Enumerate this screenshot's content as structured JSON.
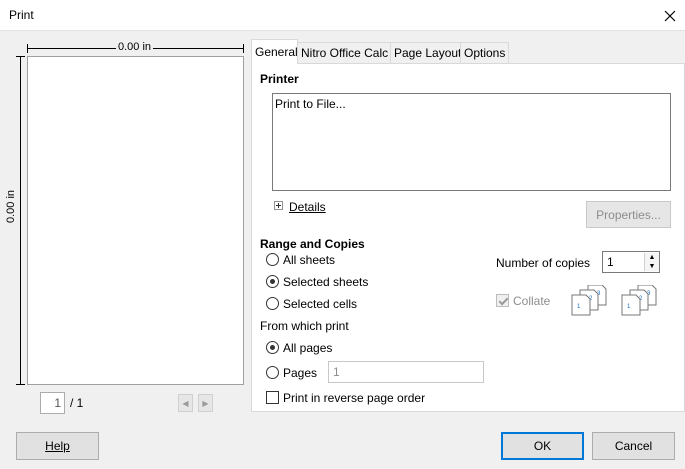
{
  "window": {
    "title": "Print"
  },
  "preview": {
    "width_label": "0.00 in",
    "height_label": "0.00 in",
    "page_current": "1",
    "page_total": "/ 1"
  },
  "tabs": [
    {
      "label": "General",
      "active": true
    },
    {
      "label": "Nitro Office Calc",
      "active": false
    },
    {
      "label": "Page Layout",
      "active": false
    },
    {
      "label": "Options",
      "active": false
    }
  ],
  "printer": {
    "section_title": "Printer",
    "items": [
      "Print to File..."
    ],
    "details_label": "Details",
    "properties_label": "Properties..."
  },
  "range": {
    "section_title": "Range and Copies",
    "options": [
      {
        "label": "All sheets",
        "checked": false
      },
      {
        "label": "Selected sheets",
        "checked": true
      },
      {
        "label": "Selected cells",
        "checked": false
      }
    ],
    "from_which_label": "From which print",
    "print_options": [
      {
        "label": "All pages",
        "checked": true
      },
      {
        "label": "Pages",
        "checked": false
      }
    ],
    "pages_value": "1",
    "reverse_label": "Print in reverse page order",
    "reverse_checked": false
  },
  "copies": {
    "label": "Number of copies",
    "value": "1",
    "collate_label": "Collate",
    "collate_checked": true,
    "collate_disabled": true
  },
  "footer": {
    "help_label": "Help",
    "ok_label": "OK",
    "cancel_label": "Cancel"
  },
  "colors": {
    "accent": "#0078d7",
    "dialog_bg": "#f0f0f0",
    "disabled_text": "#8d8d8d"
  }
}
